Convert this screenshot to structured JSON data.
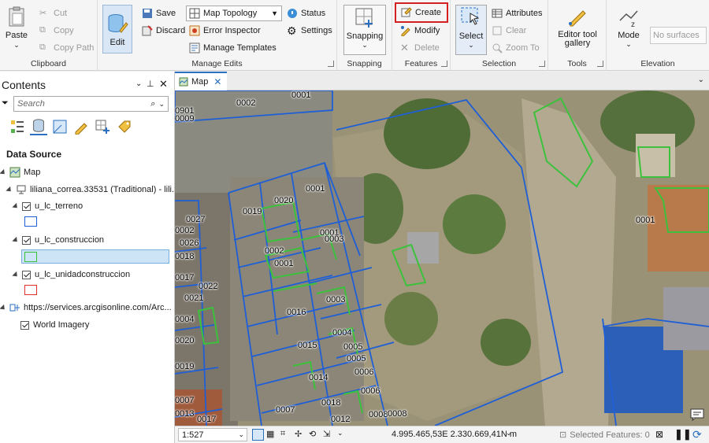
{
  "ribbon": {
    "clipboard": {
      "label": "Clipboard",
      "paste": "Paste",
      "cut": "Cut",
      "copy": "Copy",
      "copy_path": "Copy Path"
    },
    "manage_edits": {
      "label": "Manage Edits",
      "edit": "Edit",
      "save": "Save",
      "discard": "Discard",
      "topology_select": "Map Topology",
      "error_inspector": "Error Inspector",
      "manage_templates": "Manage Templates",
      "status": "Status",
      "settings": "Settings"
    },
    "snapping": {
      "label": "Snapping",
      "button": "Snapping"
    },
    "features": {
      "label": "Features",
      "create": "Create",
      "modify": "Modify",
      "delete": "Delete"
    },
    "selection": {
      "label": "Selection",
      "select": "Select",
      "attributes": "Attributes",
      "clear": "Clear",
      "zoom_to": "Zoom To"
    },
    "tools": {
      "label": "Tools",
      "gallery": "Editor tool gallery"
    },
    "elevation": {
      "label": "Elevation",
      "mode": "Mode",
      "surface_placeholder": "No surfaces"
    }
  },
  "contents": {
    "title": "Contents",
    "search_placeholder": "Search",
    "section": "Data Source",
    "map": "Map",
    "connection": "liliana_correa.33531 (Traditional) - lili...",
    "layers": [
      {
        "name": "u_lc_terreno",
        "color": "#1f5fd6"
      },
      {
        "name": "u_lc_construccion",
        "color": "#3cc13c"
      },
      {
        "name": "u_lc_unidadconstruccion",
        "color": "#e03030"
      }
    ],
    "service": "https://services.arcgisonline.com/Arc...",
    "basemap": "World Imagery"
  },
  "map": {
    "tab_label": "Map",
    "parcel_labels": [
      "0901",
      "0002",
      "0001",
      "0009",
      "0001",
      "0020",
      "0019",
      "0001",
      "0027",
      "0002",
      "0026",
      "0018",
      "0002",
      "0003",
      "0001",
      "0017",
      "0022",
      "0003",
      "0021",
      "0004",
      "0016",
      "0004",
      "0005",
      "0020",
      "0015",
      "0005",
      "0006",
      "0019",
      "0014",
      "0006",
      "0007",
      "0018",
      "0013",
      "0007",
      "0008",
      "0017",
      "0012",
      "0008",
      "0001"
    ]
  },
  "status": {
    "scale": "1:527",
    "coords": "4.995.465,53E 2.330.669,41N m",
    "selected": "Selected Features: 0"
  }
}
